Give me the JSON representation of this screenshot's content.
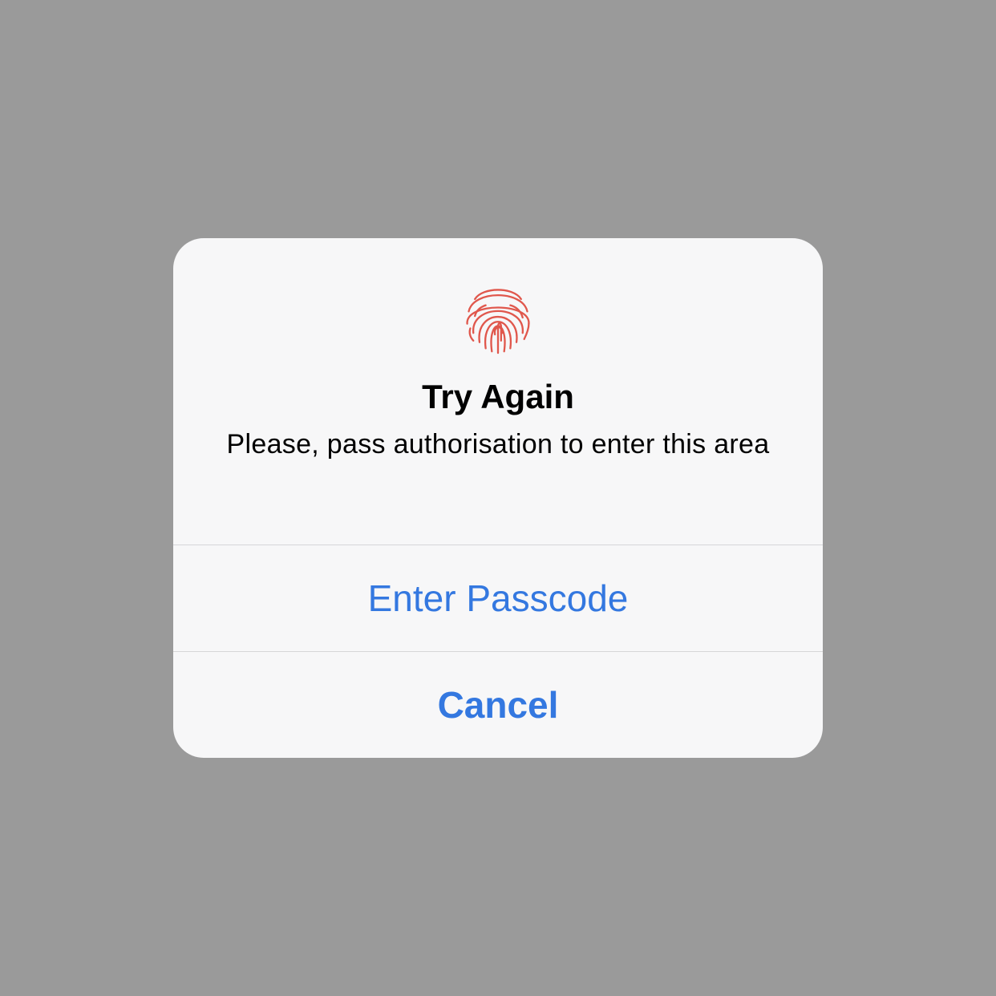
{
  "colors": {
    "backdrop": "#9a9a9a",
    "alert_background": "#f7f7f8",
    "accent": "#3478e0",
    "fingerprint": "#e0574c"
  },
  "alert": {
    "icon": "fingerprint-icon",
    "title": "Try Again",
    "message": "Please, pass authorisation to enter this area",
    "actions": [
      {
        "label": "Enter Passcode"
      },
      {
        "label": "Cancel"
      }
    ]
  }
}
